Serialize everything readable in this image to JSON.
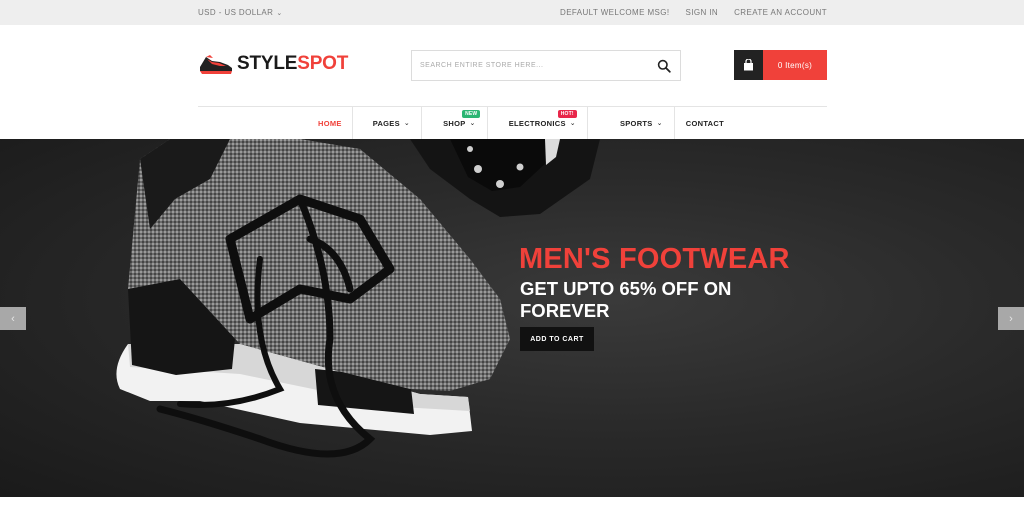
{
  "topbar": {
    "currency": "USD - US DOLLAR",
    "links": [
      "DEFAULT WELCOME MSG!",
      "SIGN IN",
      "CREATE AN ACCOUNT"
    ]
  },
  "logo": {
    "part1": "STYLE",
    "part2": "SPOT",
    "icon": "sneaker-icon"
  },
  "search": {
    "placeholder": "SEARCH ENTIRE STORE HERE...",
    "icon": "search-icon"
  },
  "cart": {
    "label": "0 Item(s)",
    "icon": "shopping-bag-icon"
  },
  "nav": {
    "home": "HOME",
    "pages": "PAGES",
    "shop": "SHOP",
    "shop_badge": "NEW",
    "electronics": "ELECTRONICS",
    "electronics_badge": "HOT!",
    "sports": "SPORTS",
    "contact": "CONTACT"
  },
  "hero": {
    "title": "MEN'S FOOTWEAR",
    "subtitle": "GET UPTO 65% OFF ON FOREVER",
    "button": "ADD TO CART"
  },
  "colors": {
    "accent": "#f0413a",
    "dark": "#222222",
    "badge_new": "#2bb673",
    "badge_hot": "#e8264a"
  }
}
